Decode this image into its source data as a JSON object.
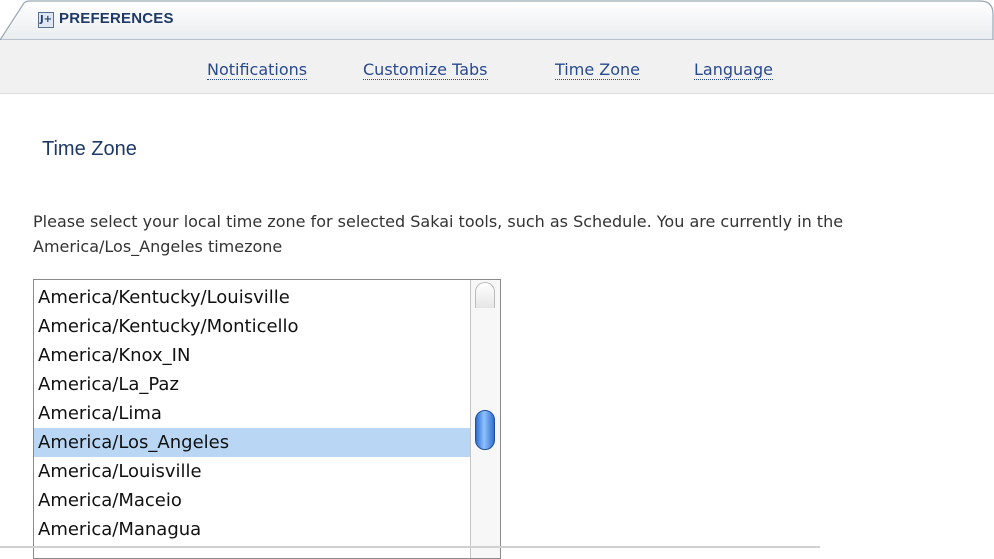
{
  "portlet": {
    "title": "PREFERENCES",
    "title_icon": "portlet-settings-icon"
  },
  "nav": {
    "notifications": "Notifications",
    "customize_tabs": "Customize Tabs",
    "time_zone": "Time Zone",
    "language": "Language"
  },
  "page_title": "Time Zone",
  "instructions": "Please select your local time zone for selected Sakai tools, such as Schedule. You are currently in the America/Los_Angeles timezone",
  "timezone_list": {
    "selected": "America/Los_Angeles",
    "options": [
      "America/Kentucky/Louisville",
      "America/Kentucky/Monticello",
      "America/Knox_IN",
      "America/La_Paz",
      "America/Lima",
      "America/Los_Angeles",
      "America/Louisville",
      "America/Maceio",
      "America/Managua"
    ]
  },
  "colors": {
    "title": "#1f3a66",
    "link": "#2a4a8e",
    "selection": "#b9d7f5"
  }
}
